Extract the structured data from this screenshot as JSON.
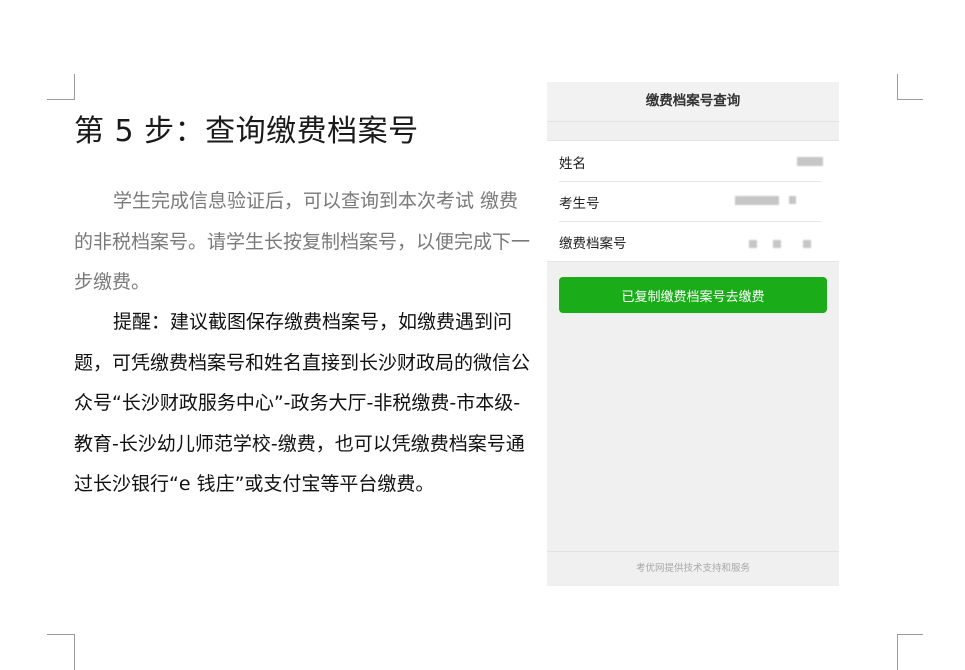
{
  "document": {
    "title": "第 5 步：查询缴费档案号",
    "paragraph1": "学生完成信息验证后，可以查询到本次考试 缴费的非税档案号。请学生长按复制档案号，以便完成下一步缴费。",
    "paragraph2": "提醒：建议截图保存缴费档案号，如缴费遇到问题，可凭缴费档案号和姓名直接到长沙财政局的微信公众号“长沙财政服务中心”-政务大厅-非税缴费-市本级-教育-长沙幼儿师范学校-缴费，也可以凭缴费档案号通过长沙银行“e 钱庄”或支付宝等平台缴费。"
  },
  "phone": {
    "header_title": "缴费档案号查询",
    "fields": [
      {
        "label": "姓名"
      },
      {
        "label": "考生号"
      },
      {
        "label": "缴费档案号"
      }
    ],
    "copy_button_label": "已复制缴费档案号去缴费",
    "footer_text": "考优网提供技术支持和服务",
    "accent_color": "#1aad19"
  }
}
